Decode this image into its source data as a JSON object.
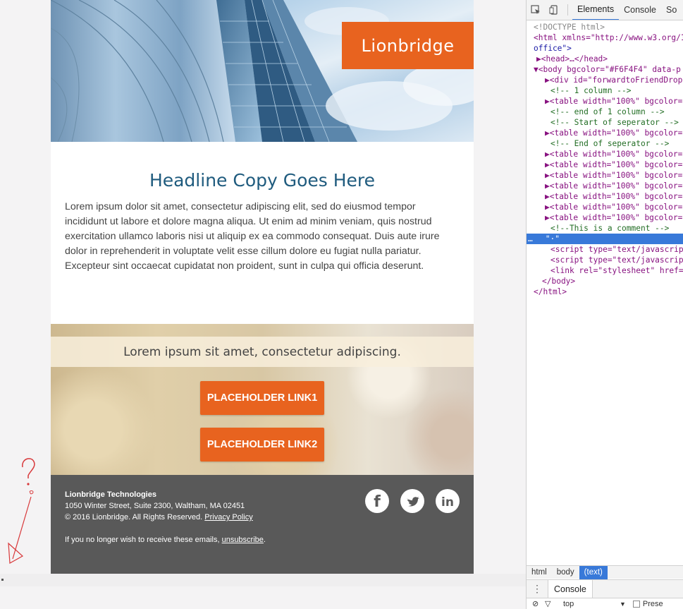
{
  "email": {
    "logo_text": "Lionbridge",
    "headline": "Headline Copy Goes Here",
    "body_copy": "Lorem ipsum dolor sit amet, consectetur adipiscing elit, sed do eiusmod tempor incididunt ut labore et dolore magna aliqua. Ut enim ad minim veniam, quis nostrud exercitation ullamco laboris nisi ut aliquip ex ea commodo consequat. Duis aute irure dolor in reprehenderit in voluptate velit esse cillum dolore eu fugiat nulla pariatur. Excepteur sint occaecat cupidatat non proident, sunt in culpa qui officia deserunt.",
    "promo_text": "Lorem ipsum sit amet, consectetur adipiscing.",
    "cta1": "PLACEHOLDER LINK1",
    "cta2": "PLACEHOLDER LINK2",
    "footer": {
      "company": "Lionbridge Technologies",
      "address": "1050 Winter Street, Suite 2300, Waltham, MA 02451",
      "copyright": "© 2016 Lionbridge. All Rights Reserved.",
      "privacy_link": "Privacy Policy",
      "unsub_prefix": "If you no longer wish to receive these emails,",
      "unsub_link": "unsubscribe",
      "unsub_suffix": ".",
      "social": [
        "facebook-icon",
        "twitter-icon",
        "linkedin-icon"
      ]
    }
  },
  "annotation": {
    "question_mark": "?",
    "small_char": "e"
  },
  "devtools": {
    "tabs": [
      "Elements",
      "Console",
      "So"
    ],
    "active_tab": "Elements",
    "dom_lines": [
      {
        "text": "<!DOCTYPE html>"
      },
      {
        "text": "<html xmlns=\"http://www.w3.org/1"
      },
      {
        "text": "office\">"
      },
      {
        "text": "▶<head>…</head>"
      },
      {
        "text": "▼<body bgcolor=\"#F6F4F4\" data-p"
      },
      {
        "text": "▶<div id=\"forwardtoFriendDrop"
      },
      {
        "text": "<!-- 1 column -->"
      },
      {
        "text": "▶<table width=\"100%\" bgcolor="
      },
      {
        "text": "<!-- end of 1 column -->"
      },
      {
        "text": "<!-- Start of seperator -->"
      },
      {
        "text": "▶<table width=\"100%\" bgcolor="
      },
      {
        "text": "<!-- End of seperator -->"
      },
      {
        "text": "▶<table width=\"100%\" bgcolor="
      },
      {
        "text": "▶<table width=\"100%\" bgcolor="
      },
      {
        "text": "▶<table width=\"100%\" bgcolor="
      },
      {
        "text": "▶<table width=\"100%\" bgcolor="
      },
      {
        "text": "▶<table width=\"100%\" bgcolor="
      },
      {
        "text": "▶<table width=\"100%\" bgcolor="
      },
      {
        "text": "▶<table width=\"100%\" bgcolor="
      },
      {
        "text": "<!--This is a comment -->"
      },
      {
        "text": "\"·\""
      },
      {
        "text": "<script type=\"text/javascrip"
      },
      {
        "text": "<script type=\"text/javascrip"
      },
      {
        "text": "<link rel=\"stylesheet\" href="
      },
      {
        "text": "</body>"
      },
      {
        "text": "</html>"
      }
    ],
    "selected_line": 20,
    "selected_prefix": "…",
    "breadcrumbs": [
      "html",
      "body",
      "(text)"
    ],
    "active_crumb": "(text)",
    "drawer_tab": "Console",
    "console_context": "top",
    "preserve_label": "Prese"
  },
  "colors": {
    "accent": "#e8631f",
    "headline": "#1f5b7e",
    "footer_bg": "#595959",
    "devtools_selection": "#3879d9"
  }
}
